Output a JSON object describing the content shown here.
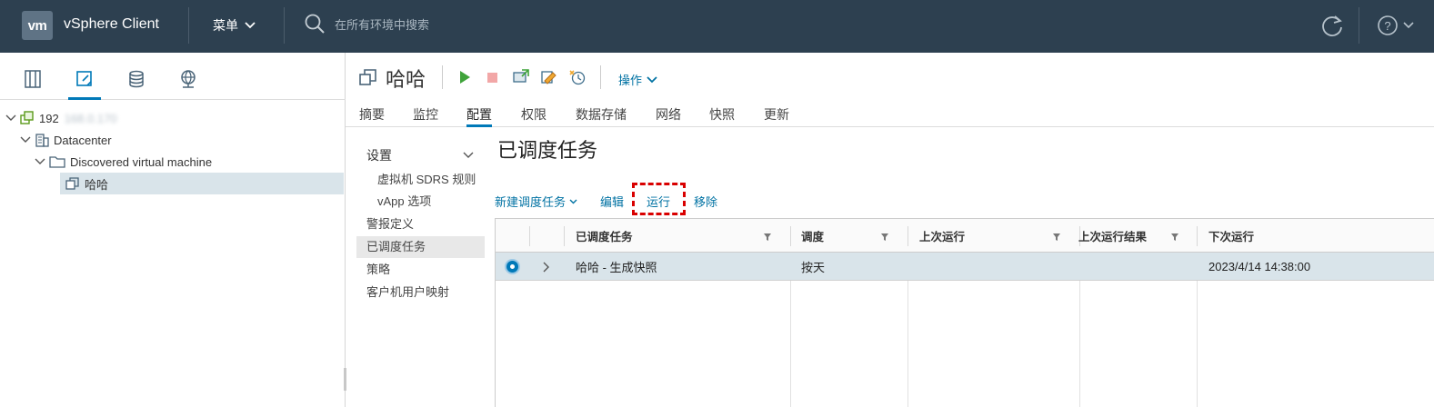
{
  "header": {
    "logo": "vm",
    "app_title": "vSphere Client",
    "menu_label": "菜单",
    "search_placeholder": "在所有环境中搜索"
  },
  "nav_tabs": [
    {
      "icon": "hosts-clusters-icon"
    },
    {
      "icon": "vms-templates-icon",
      "active": true
    },
    {
      "icon": "storage-icon"
    },
    {
      "icon": "networking-icon"
    }
  ],
  "tree": {
    "host_label": "192",
    "host_blurred": "168.0.170",
    "datacenter": "Datacenter",
    "folder": "Discovered virtual machine",
    "vm": "哈哈"
  },
  "object": {
    "title": "哈哈",
    "actions_label": "操作"
  },
  "tabs": [
    "摘要",
    "监控",
    "配置",
    "权限",
    "数据存储",
    "网络",
    "快照",
    "更新"
  ],
  "active_tab": "配置",
  "config_nav": {
    "section": "设置",
    "items": [
      "虚拟机 SDRS 规则",
      "vApp 选项",
      "警报定义",
      "已调度任务",
      "策略",
      "客户机用户映射"
    ],
    "active": "已调度任务"
  },
  "panel": {
    "title": "已调度任务",
    "new_task": "新建调度任务",
    "edit": "编辑",
    "run": "运行",
    "remove": "移除"
  },
  "grid": {
    "columns": [
      "已调度任务",
      "调度",
      "上次运行",
      "上次运行结果",
      "下次运行"
    ],
    "rows": [
      {
        "task": "哈哈 - 生成快照",
        "schedule": "按天",
        "last_run": "",
        "last_result": "",
        "next_run": "2023/4/14 14:38:00"
      }
    ]
  },
  "colors": {
    "header_bg": "#2d4050",
    "accent": "#0079b8",
    "link": "#0072a3",
    "highlight": "#d90000",
    "selected_row": "#d9e4ea"
  }
}
